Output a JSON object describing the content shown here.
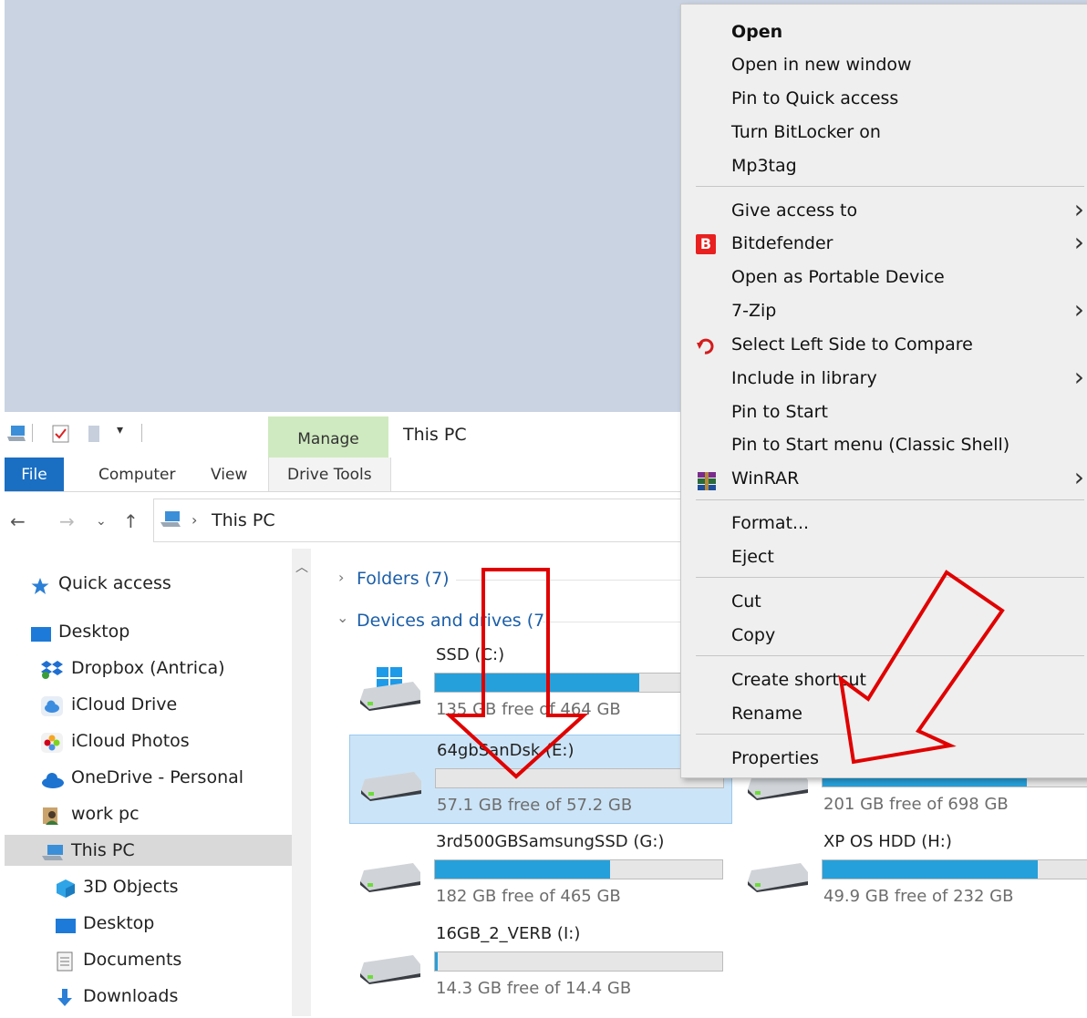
{
  "ribbon": {
    "manage_label": "Manage",
    "window_title": "This PC",
    "file_tab": "File",
    "computer_tab": "Computer",
    "view_tab": "View",
    "drive_tools_tab": "Drive Tools"
  },
  "address": {
    "location": "This PC"
  },
  "nav_pane": {
    "items": [
      {
        "label": "Quick access",
        "icon": "star-icon"
      },
      {
        "label": "Desktop",
        "icon": "desktop-folder-icon"
      },
      {
        "label": "Dropbox (Antrica)",
        "icon": "dropbox-icon"
      },
      {
        "label": "iCloud Drive",
        "icon": "icloud-icon"
      },
      {
        "label": "iCloud Photos",
        "icon": "photos-icon"
      },
      {
        "label": "OneDrive - Personal",
        "icon": "onedrive-icon"
      },
      {
        "label": "work pc",
        "icon": "user-icon"
      },
      {
        "label": "This PC",
        "icon": "computer-icon"
      },
      {
        "label": "3D Objects",
        "icon": "cube-icon"
      },
      {
        "label": "Desktop",
        "icon": "desktop-folder-icon"
      },
      {
        "label": "Documents",
        "icon": "document-icon"
      },
      {
        "label": "Downloads",
        "icon": "download-arrow-icon"
      }
    ]
  },
  "content": {
    "folders_header": "Folders (7)",
    "devices_header": "Devices and drives (7)",
    "drives": [
      {
        "name": "SSD (C:)",
        "free": "135 GB free of 464 GB",
        "used_fraction": 0.71
      },
      {
        "name": "64gbSanDsk (E:)",
        "free": "57.1 GB free of 57.2 GB",
        "used_fraction": 0.0
      },
      {
        "name": "",
        "free": "201 GB free of 698 GB",
        "used_fraction": 0.71
      },
      {
        "name": "3rd500GBSamsungSSD (G:)",
        "free": "182 GB free of 465 GB",
        "used_fraction": 0.61
      },
      {
        "name": "XP OS HDD (H:)",
        "free": "49.9 GB free of 232 GB",
        "used_fraction": 0.785
      },
      {
        "name": "16GB_2_VERB (I:)",
        "free": "14.3 GB free of 14.4 GB",
        "used_fraction": 0.01
      }
    ]
  },
  "context_menu": {
    "items": [
      {
        "label": "Open",
        "bold": true
      },
      {
        "label": "Open in new window"
      },
      {
        "label": "Pin to Quick access"
      },
      {
        "label": "Turn BitLocker on"
      },
      {
        "label": "Mp3tag"
      },
      {
        "label": "Give access to",
        "submenu": true
      },
      {
        "label": "Bitdefender",
        "submenu": true,
        "icon": "bitdefender-icon"
      },
      {
        "label": "Open as Portable Device"
      },
      {
        "label": "7-Zip",
        "submenu": true
      },
      {
        "label": "Select Left Side to Compare",
        "icon": "compare-icon"
      },
      {
        "label": "Include in library",
        "submenu": true
      },
      {
        "label": "Pin to Start"
      },
      {
        "label": "Pin to Start menu (Classic Shell)"
      },
      {
        "label": "WinRAR",
        "submenu": true,
        "icon": "winrar-icon"
      },
      {
        "label": "Format..."
      },
      {
        "label": "Eject"
      },
      {
        "label": "Cut"
      },
      {
        "label": "Copy"
      },
      {
        "label": "Create shortcut"
      },
      {
        "label": "Rename"
      },
      {
        "label": "Properties"
      }
    ],
    "bitdefender_letter": "B"
  },
  "colors": {
    "accent_blue": "#1a6fc3",
    "manage_green": "#cfeac0",
    "drive_bar_fill": "#26a0da",
    "annotation_red": "#e00000"
  }
}
